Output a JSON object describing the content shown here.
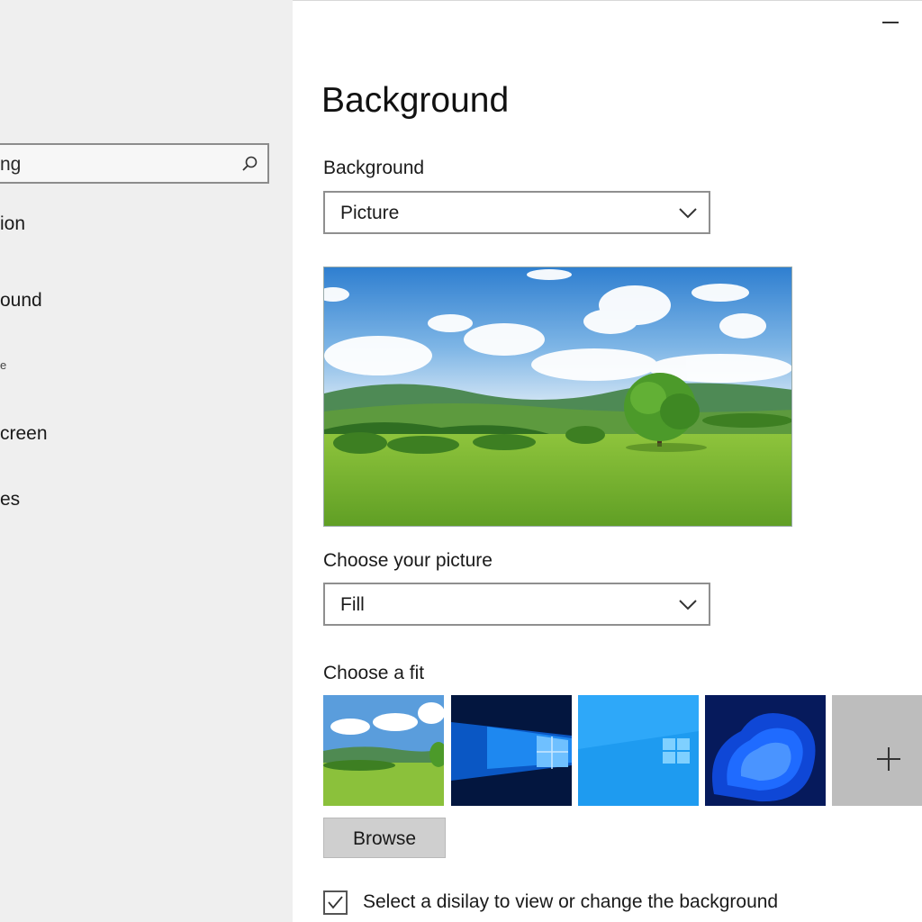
{
  "sidebar": {
    "search_text": "ng",
    "items": [
      {
        "label": "ion"
      },
      {
        "label": "ound"
      },
      {
        "label": "e"
      },
      {
        "label": "creen"
      },
      {
        "label": "es"
      }
    ]
  },
  "window": {
    "minimize_icon": "minimize-icon"
  },
  "main": {
    "title": "Background",
    "background_label": "Background",
    "background_value": "Picture",
    "choose_picture_label": "Choose your picture",
    "picture_value": "Fill",
    "fit_label": "Choose a fit",
    "thumbnails": [
      "landscape",
      "windows-10-blue",
      "windows-light-blue",
      "windows-11-bloom"
    ],
    "browse_label": "Browse",
    "checkbox_checked": true,
    "checkbox_label": "Select a disilay to view or change the background"
  },
  "colors": {
    "sidebar_bg": "#efefef",
    "accent_blue": "#0a74da"
  }
}
